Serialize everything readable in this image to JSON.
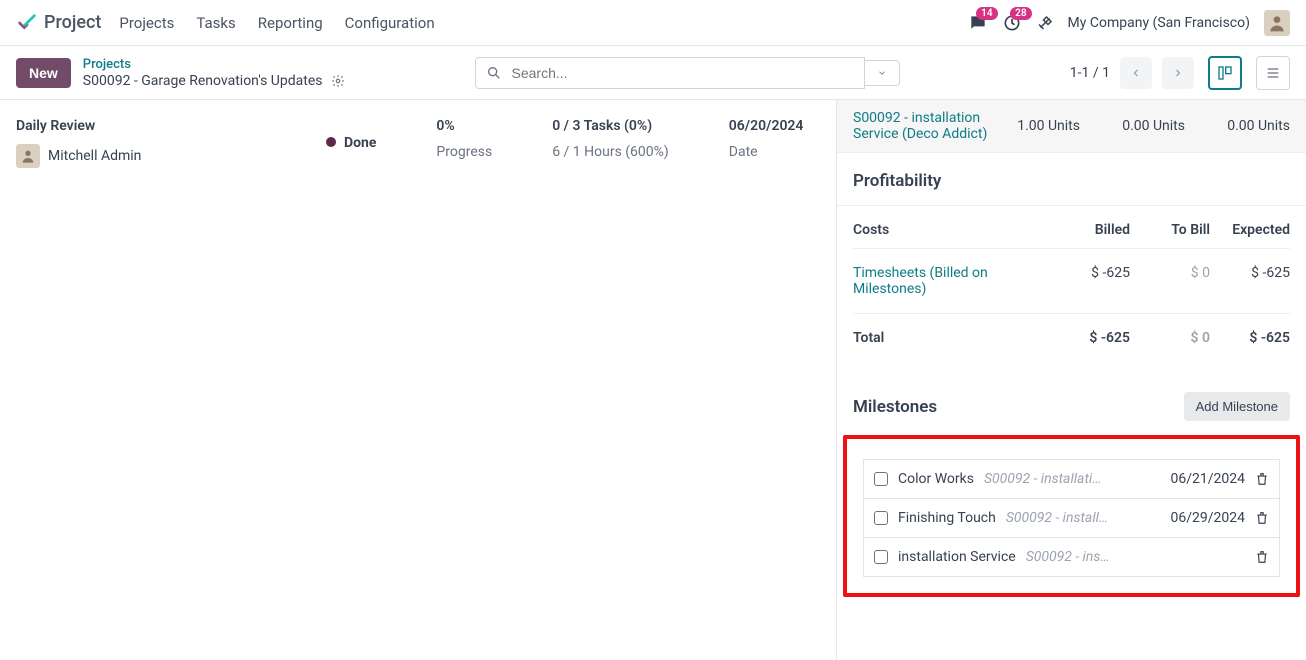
{
  "app": {
    "name": "Project"
  },
  "nav": [
    "Projects",
    "Tasks",
    "Reporting",
    "Configuration"
  ],
  "topbar": {
    "msg_count": "14",
    "activity_count": "28",
    "company": "My Company (San Francisco)"
  },
  "actions": {
    "new_label": "New",
    "breadcrumb_top": "Projects",
    "breadcrumb_title": "S00092 - Garage Renovation's Updates",
    "search_placeholder": "Search...",
    "pager": "1-1 / 1"
  },
  "record": {
    "title": "Daily Review",
    "user": "Mitchell Admin",
    "status": "Done",
    "progress_pct": "0%",
    "progress_lbl": "Progress",
    "tasks": "0 / 3 Tasks (0%)",
    "hours": "6 / 1 Hours (600%)",
    "date": "06/20/2024",
    "date_lbl": "Date"
  },
  "side_item": {
    "link": "S00092 - installation Service (Deco Addict)",
    "u1": "1.00 Units",
    "u2": "0.00 Units",
    "u3": "0.00 Units"
  },
  "profitability": {
    "header": "Profitability",
    "cols": [
      "Costs",
      "Billed",
      "To Bill",
      "Expected"
    ],
    "row_name": "Timesheets (Billed on Milestones)",
    "row": [
      "$ -625",
      "$ 0",
      "$ -625"
    ],
    "total_lbl": "Total",
    "total": [
      "$ -625",
      "$ 0",
      "$ -625"
    ]
  },
  "milestones": {
    "header": "Milestones",
    "add_label": "Add Milestone",
    "items": [
      {
        "name": "Color Works",
        "ref": "S00092 - installati…",
        "date": "06/21/2024"
      },
      {
        "name": "Finishing Touch",
        "ref": "S00092 - install…",
        "date": "06/29/2024"
      },
      {
        "name": "installation Service",
        "ref": "S00092 - ins…",
        "date": ""
      }
    ]
  }
}
